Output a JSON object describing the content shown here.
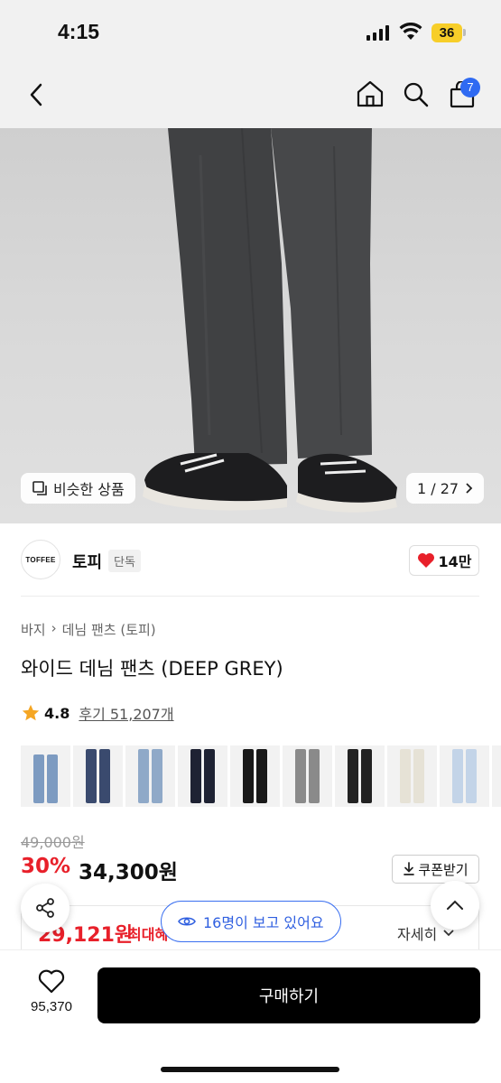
{
  "status_bar": {
    "time": "4:15",
    "battery": "36"
  },
  "nav": {
    "cart_count": "7"
  },
  "gallery": {
    "similar_label": "비슷한 상품",
    "counter": "1 / 27"
  },
  "brand": {
    "logo_text": "TOFFEE",
    "name": "토피",
    "tag": "단독",
    "likes": "14만"
  },
  "breadcrumb": [
    "바지",
    "데님 팬츠 (토피)"
  ],
  "product": {
    "title": "와이드 데님 팬츠 (DEEP GREY)",
    "rating": "4.8",
    "reviews": "후기 51,207개"
  },
  "variants": [
    {
      "leg": "#7d9bc1"
    },
    {
      "leg": "#3a4a6e"
    },
    {
      "leg": "#8fa9c8"
    },
    {
      "leg": "#1e2233"
    },
    {
      "leg": "#1a1a1a"
    },
    {
      "leg": "#8a8a8a"
    },
    {
      "leg": "#222222"
    },
    {
      "leg": "#e6e2d6"
    },
    {
      "leg": "#c3d4e8"
    },
    {
      "leg": "#555555"
    }
  ],
  "pricing": {
    "original": "49,000원",
    "discount": "30%",
    "price": "34,300원",
    "coupon_label": "쿠폰받기",
    "best_price": "29,121원",
    "best_label": "최대혜",
    "detail_label": "자세히"
  },
  "viewers_text": "16명이 보고 있어요",
  "bottom": {
    "like_count": "95,370",
    "buy_label": "구매하기"
  },
  "colors": {
    "accent_red": "#e8202a",
    "accent_blue": "#2f6af2",
    "buy_button": "#000000"
  }
}
